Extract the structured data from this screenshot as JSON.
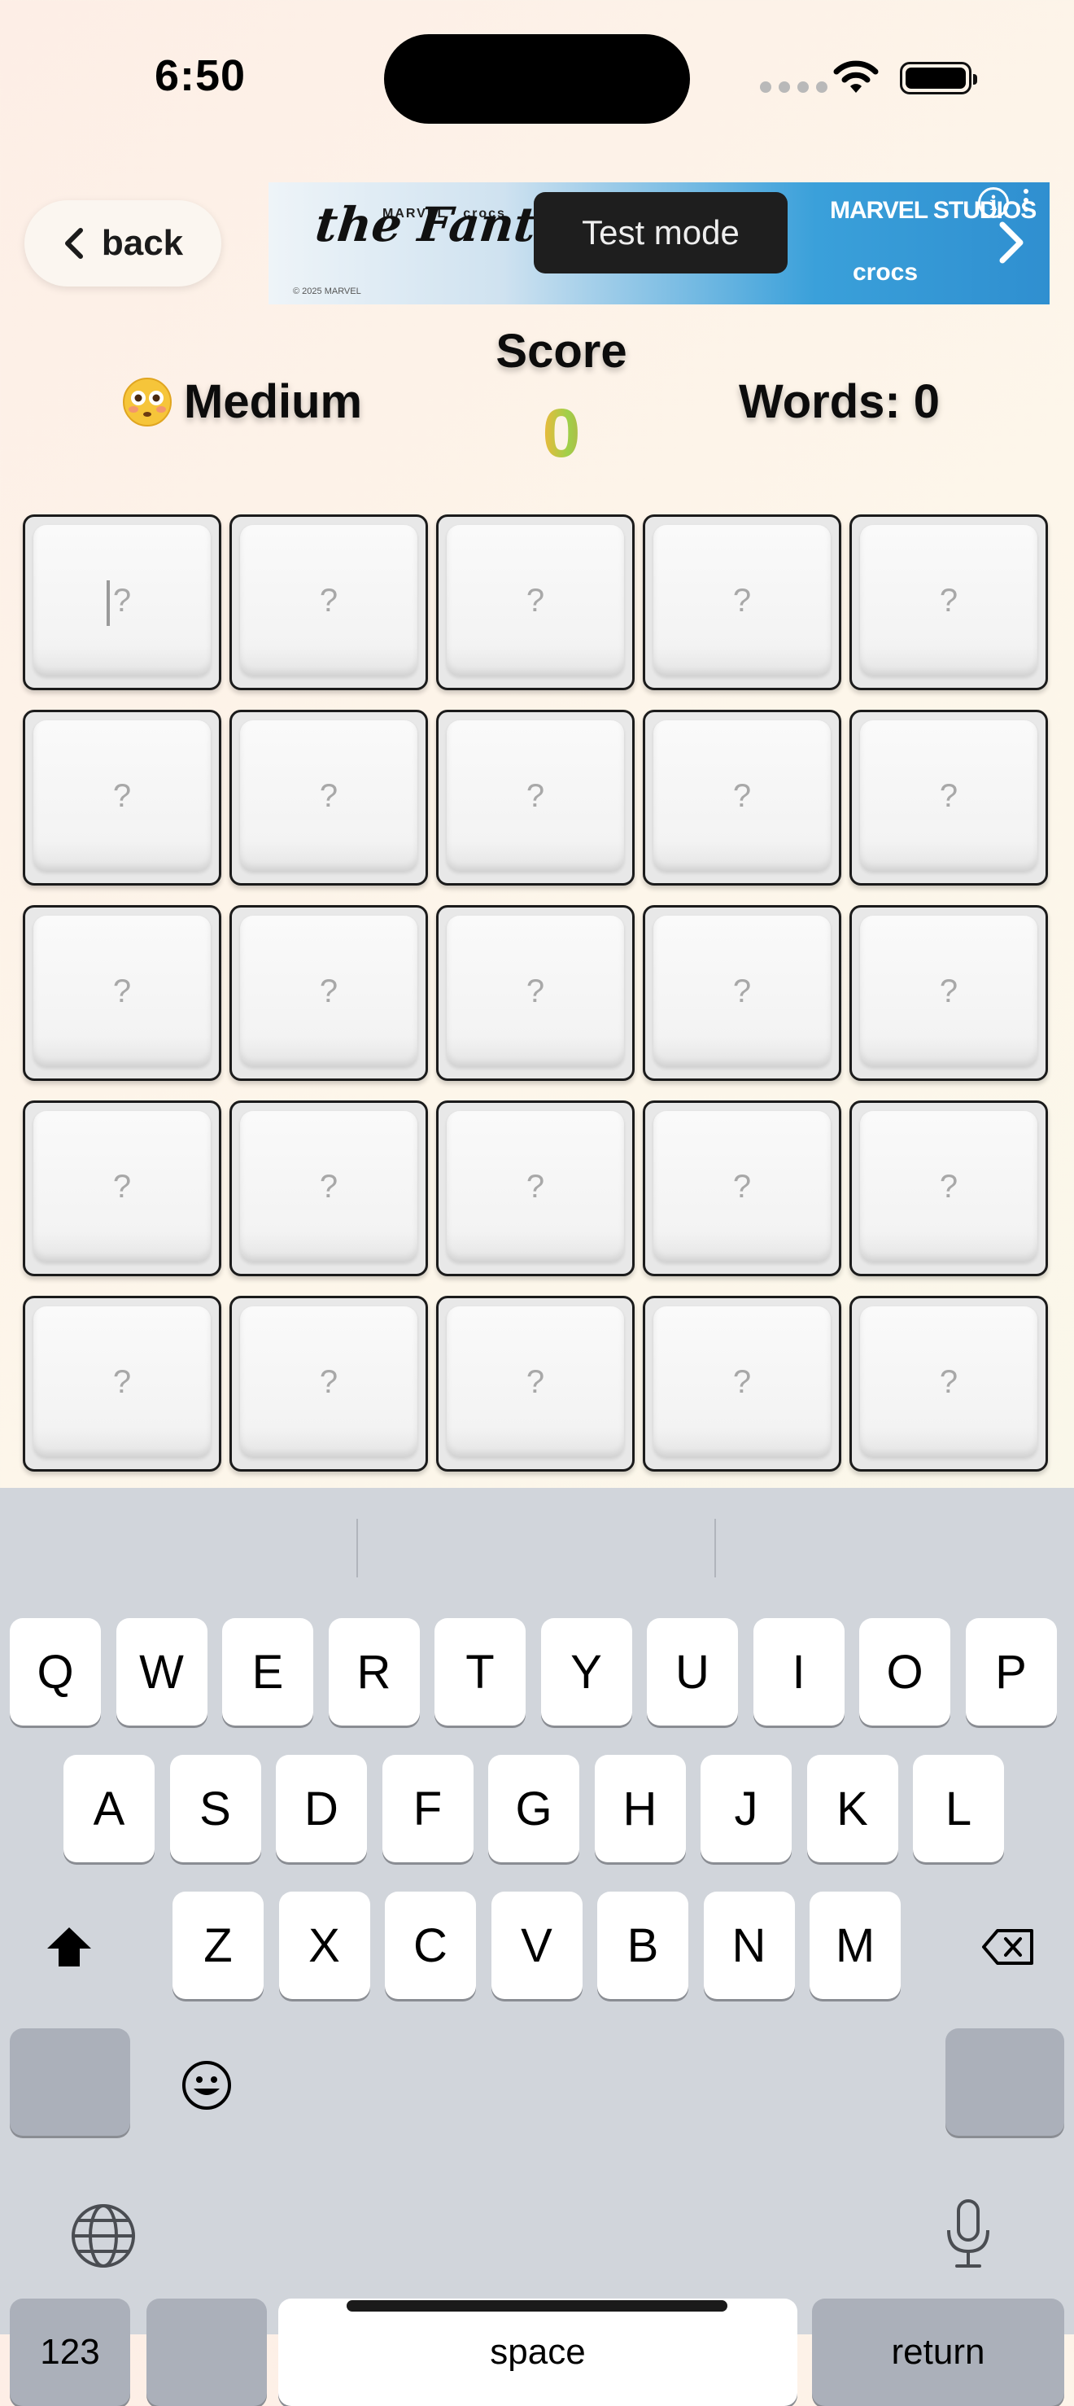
{
  "status_bar": {
    "time": "6:50"
  },
  "header": {
    "back_label": "back"
  },
  "ad": {
    "brand_top": "MARVEL · crocs",
    "title": "the Fantastic 4",
    "fine_print": "© 2025 MARVEL",
    "toast": "Test mode",
    "studios": "MARVEL STUDIOS",
    "partner": "crocs"
  },
  "stats": {
    "difficulty": "Medium",
    "score_label": "Score",
    "score_value": "0",
    "words": "Words: 0"
  },
  "grid": {
    "rows": 5,
    "cols": 5,
    "placeholder": "?"
  },
  "keyboard": {
    "row1": [
      "Q",
      "W",
      "E",
      "R",
      "T",
      "Y",
      "U",
      "I",
      "O",
      "P"
    ],
    "row2": [
      "A",
      "S",
      "D",
      "F",
      "G",
      "H",
      "J",
      "K",
      "L"
    ],
    "row3": [
      "Z",
      "X",
      "C",
      "V",
      "B",
      "N",
      "M"
    ],
    "numbers_label": "123",
    "space_label": "space",
    "return_label": "return"
  }
}
